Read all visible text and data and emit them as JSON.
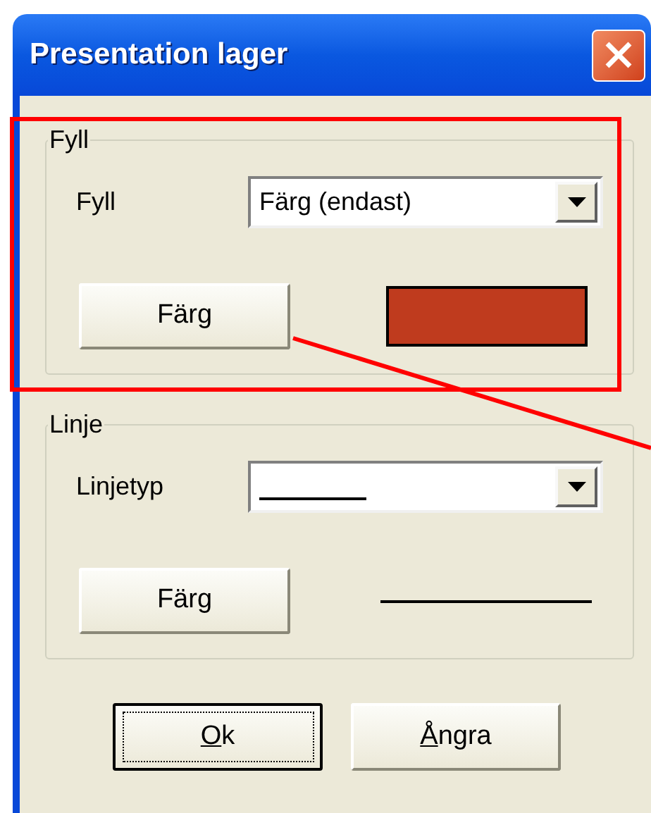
{
  "window": {
    "title": "Presentation lager"
  },
  "groups": [
    {
      "title": "Fyll",
      "field_label": "Fyll",
      "dropdown": {
        "kind": "text",
        "value": "Färg (endast)"
      },
      "button": "Färg",
      "preview": {
        "kind": "swatch",
        "color": "#bf3b1e"
      }
    },
    {
      "title": "Linje",
      "field_label": "Linjetyp",
      "dropdown": {
        "kind": "line"
      },
      "button": "Färg",
      "preview": {
        "kind": "line"
      }
    }
  ],
  "buttons": [
    {
      "label": "Ok",
      "first_letter_underlined": true,
      "default": true
    },
    {
      "label": "Ångra",
      "first_letter_underlined": true,
      "default": false
    }
  ],
  "annotations": {
    "highlight_box": true,
    "leader_line": true
  }
}
